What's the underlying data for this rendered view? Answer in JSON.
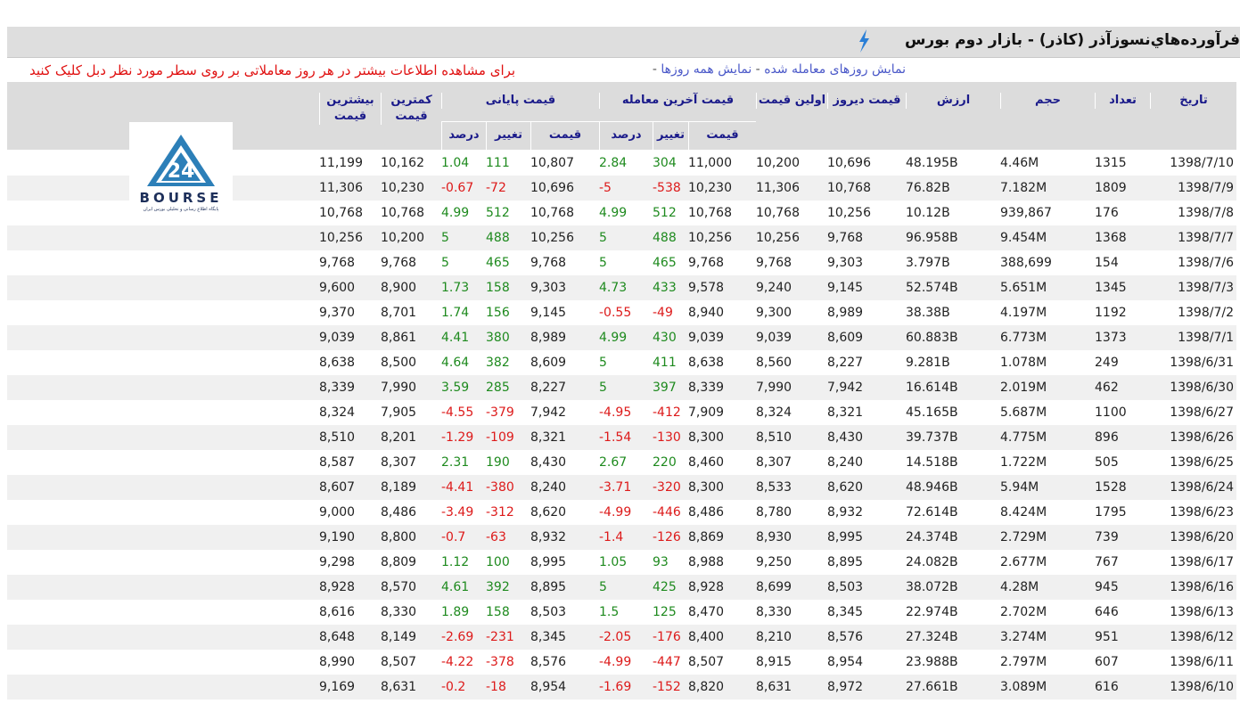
{
  "title": "فرآورده‌هاي‌نسوزآذر (کاذر) - بازار دوم بورس",
  "info": {
    "link_traded": "نمایش روزهای معامله شده",
    "sep1": " - ",
    "link_all": "نمایش همه روزها",
    "sep2": " - ",
    "hint": "برای مشاهده اطلاعات بیشتر در هر روز معاملاتی بر روی سطر مورد نظر دبل کلیک کنید"
  },
  "logo": {
    "text": "BOURSE",
    "sub": "پایگاه اطلاع رسانی و تحلیلی بورس ایران",
    "mark": "24"
  },
  "headers": {
    "date": "تاریخ",
    "count": "تعداد",
    "volume": "حجم",
    "value": "ارزش",
    "prev_price": "قیمت دیروز",
    "first_price": "اولین قیمت",
    "last_trade": "قیمت آخرین معامله",
    "closing": "قیمت پایانی",
    "min": "کمترین قیمت",
    "max": "بیشترین قیمت",
    "sub_price": "قیمت",
    "sub_change": "تغییر",
    "sub_percent": "درصد"
  },
  "rows": [
    {
      "max": "11,199",
      "min": "10,162",
      "cp": "1.04",
      "cc": "111",
      "close": "10,807",
      "lp": "2.84",
      "lc": "304",
      "last": "11,000",
      "first": "10,200",
      "prev": "10,696",
      "value": "48.195B",
      "volume": "4.46M",
      "count": "1315",
      "date": "1398/7/10"
    },
    {
      "max": "11,306",
      "min": "10,230",
      "cp": "-0.67",
      "cc": "-72",
      "close": "10,696",
      "lp": "-5",
      "lc": "-538",
      "last": "10,230",
      "first": "11,306",
      "prev": "10,768",
      "value": "76.82B",
      "volume": "7.182M",
      "count": "1809",
      "date": "1398/7/9"
    },
    {
      "max": "10,768",
      "min": "10,768",
      "cp": "4.99",
      "cc": "512",
      "close": "10,768",
      "lp": "4.99",
      "lc": "512",
      "last": "10,768",
      "first": "10,768",
      "prev": "10,256",
      "value": "10.12B",
      "volume": "939,867",
      "count": "176",
      "date": "1398/7/8"
    },
    {
      "max": "10,256",
      "min": "10,200",
      "cp": "5",
      "cc": "488",
      "close": "10,256",
      "lp": "5",
      "lc": "488",
      "last": "10,256",
      "first": "10,256",
      "prev": "9,768",
      "value": "96.958B",
      "volume": "9.454M",
      "count": "1368",
      "date": "1398/7/7"
    },
    {
      "max": "9,768",
      "min": "9,768",
      "cp": "5",
      "cc": "465",
      "close": "9,768",
      "lp": "5",
      "lc": "465",
      "last": "9,768",
      "first": "9,768",
      "prev": "9,303",
      "value": "3.797B",
      "volume": "388,699",
      "count": "154",
      "date": "1398/7/6"
    },
    {
      "max": "9,600",
      "min": "8,900",
      "cp": "1.73",
      "cc": "158",
      "close": "9,303",
      "lp": "4.73",
      "lc": "433",
      "last": "9,578",
      "first": "9,240",
      "prev": "9,145",
      "value": "52.574B",
      "volume": "5.651M",
      "count": "1345",
      "date": "1398/7/3"
    },
    {
      "max": "9,370",
      "min": "8,701",
      "cp": "1.74",
      "cc": "156",
      "close": "9,145",
      "lp": "-0.55",
      "lc": "-49",
      "last": "8,940",
      "first": "9,300",
      "prev": "8,989",
      "value": "38.38B",
      "volume": "4.197M",
      "count": "1192",
      "date": "1398/7/2"
    },
    {
      "max": "9,039",
      "min": "8,861",
      "cp": "4.41",
      "cc": "380",
      "close": "8,989",
      "lp": "4.99",
      "lc": "430",
      "last": "9,039",
      "first": "9,039",
      "prev": "8,609",
      "value": "60.883B",
      "volume": "6.773M",
      "count": "1373",
      "date": "1398/7/1"
    },
    {
      "max": "8,638",
      "min": "8,500",
      "cp": "4.64",
      "cc": "382",
      "close": "8,609",
      "lp": "5",
      "lc": "411",
      "last": "8,638",
      "first": "8,560",
      "prev": "8,227",
      "value": "9.281B",
      "volume": "1.078M",
      "count": "249",
      "date": "1398/6/31"
    },
    {
      "max": "8,339",
      "min": "7,990",
      "cp": "3.59",
      "cc": "285",
      "close": "8,227",
      "lp": "5",
      "lc": "397",
      "last": "8,339",
      "first": "7,990",
      "prev": "7,942",
      "value": "16.614B",
      "volume": "2.019M",
      "count": "462",
      "date": "1398/6/30"
    },
    {
      "max": "8,324",
      "min": "7,905",
      "cp": "-4.55",
      "cc": "-379",
      "close": "7,942",
      "lp": "-4.95",
      "lc": "-412",
      "last": "7,909",
      "first": "8,324",
      "prev": "8,321",
      "value": "45.165B",
      "volume": "5.687M",
      "count": "1100",
      "date": "1398/6/27"
    },
    {
      "max": "8,510",
      "min": "8,201",
      "cp": "-1.29",
      "cc": "-109",
      "close": "8,321",
      "lp": "-1.54",
      "lc": "-130",
      "last": "8,300",
      "first": "8,510",
      "prev": "8,430",
      "value": "39.737B",
      "volume": "4.775M",
      "count": "896",
      "date": "1398/6/26"
    },
    {
      "max": "8,587",
      "min": "8,307",
      "cp": "2.31",
      "cc": "190",
      "close": "8,430",
      "lp": "2.67",
      "lc": "220",
      "last": "8,460",
      "first": "8,307",
      "prev": "8,240",
      "value": "14.518B",
      "volume": "1.722M",
      "count": "505",
      "date": "1398/6/25"
    },
    {
      "max": "8,607",
      "min": "8,189",
      "cp": "-4.41",
      "cc": "-380",
      "close": "8,240",
      "lp": "-3.71",
      "lc": "-320",
      "last": "8,300",
      "first": "8,533",
      "prev": "8,620",
      "value": "48.946B",
      "volume": "5.94M",
      "count": "1528",
      "date": "1398/6/24"
    },
    {
      "max": "9,000",
      "min": "8,486",
      "cp": "-3.49",
      "cc": "-312",
      "close": "8,620",
      "lp": "-4.99",
      "lc": "-446",
      "last": "8,486",
      "first": "8,780",
      "prev": "8,932",
      "value": "72.614B",
      "volume": "8.424M",
      "count": "1795",
      "date": "1398/6/23"
    },
    {
      "max": "9,190",
      "min": "8,800",
      "cp": "-0.7",
      "cc": "-63",
      "close": "8,932",
      "lp": "-1.4",
      "lc": "-126",
      "last": "8,869",
      "first": "8,930",
      "prev": "8,995",
      "value": "24.374B",
      "volume": "2.729M",
      "count": "739",
      "date": "1398/6/20"
    },
    {
      "max": "9,298",
      "min": "8,809",
      "cp": "1.12",
      "cc": "100",
      "close": "8,995",
      "lp": "1.05",
      "lc": "93",
      "last": "8,988",
      "first": "9,250",
      "prev": "8,895",
      "value": "24.082B",
      "volume": "2.677M",
      "count": "767",
      "date": "1398/6/17"
    },
    {
      "max": "8,928",
      "min": "8,570",
      "cp": "4.61",
      "cc": "392",
      "close": "8,895",
      "lp": "5",
      "lc": "425",
      "last": "8,928",
      "first": "8,699",
      "prev": "8,503",
      "value": "38.072B",
      "volume": "4.28M",
      "count": "945",
      "date": "1398/6/16"
    },
    {
      "max": "8,616",
      "min": "8,330",
      "cp": "1.89",
      "cc": "158",
      "close": "8,503",
      "lp": "1.5",
      "lc": "125",
      "last": "8,470",
      "first": "8,330",
      "prev": "8,345",
      "value": "22.974B",
      "volume": "2.702M",
      "count": "646",
      "date": "1398/6/13"
    },
    {
      "max": "8,648",
      "min": "8,149",
      "cp": "-2.69",
      "cc": "-231",
      "close": "8,345",
      "lp": "-2.05",
      "lc": "-176",
      "last": "8,400",
      "first": "8,210",
      "prev": "8,576",
      "value": "27.324B",
      "volume": "3.274M",
      "count": "951",
      "date": "1398/6/12"
    },
    {
      "max": "8,990",
      "min": "8,507",
      "cp": "-4.22",
      "cc": "-378",
      "close": "8,576",
      "lp": "-4.99",
      "lc": "-447",
      "last": "8,507",
      "first": "8,915",
      "prev": "8,954",
      "value": "23.988B",
      "volume": "2.797M",
      "count": "607",
      "date": "1398/6/11"
    },
    {
      "max": "9,169",
      "min": "8,631",
      "cp": "-0.2",
      "cc": "-18",
      "close": "8,954",
      "lp": "-1.69",
      "lc": "-152",
      "last": "8,820",
      "first": "8,631",
      "prev": "8,972",
      "value": "27.661B",
      "volume": "3.089M",
      "count": "616",
      "date": "1398/6/10"
    }
  ],
  "colors": {
    "positive": "#1e8a1e",
    "negative": "#dd1a1a",
    "header_text": "#1a1a8a",
    "hint": "#e01010",
    "link": "#4a58c8",
    "bolt": "#2b7fd6"
  }
}
